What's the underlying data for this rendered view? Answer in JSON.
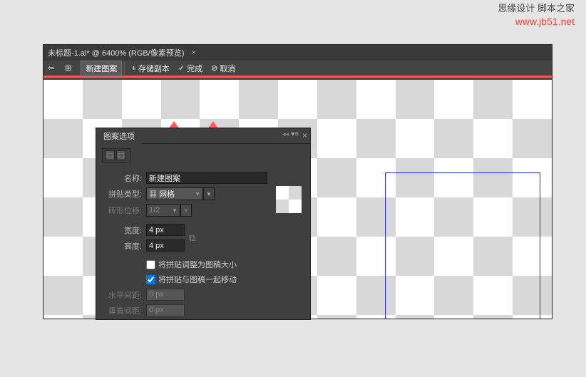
{
  "watermark": {
    "line1": "思缘设计 脚本之家",
    "line2": "www.jb51.net"
  },
  "tab": {
    "title": "未标题-1.ai* @ 6400% (RGB/像素预览)"
  },
  "action_bar": {
    "mode": "新建图案",
    "save": "存储副本",
    "done": "完成",
    "cancel": "取消"
  },
  "panel": {
    "title": "图案选项",
    "name_label": "名称:",
    "name_value": "新建图案",
    "tile_type_label": "拼贴类型:",
    "tile_type_value": "网格",
    "brick_offset_label": "砖形位移:",
    "brick_offset_value": "1/2",
    "width_label": "宽度:",
    "width_value": "4 px",
    "height_label": "高度:",
    "height_value": "4 px",
    "cb1": "将拼贴调整为图稿大小",
    "cb2": "将拼贴与图稿一起移动",
    "hspace_label": "水平间距:",
    "hspace_value": "0 px",
    "vspace_label": "垂直间距:",
    "vspace_value": "0 px"
  }
}
